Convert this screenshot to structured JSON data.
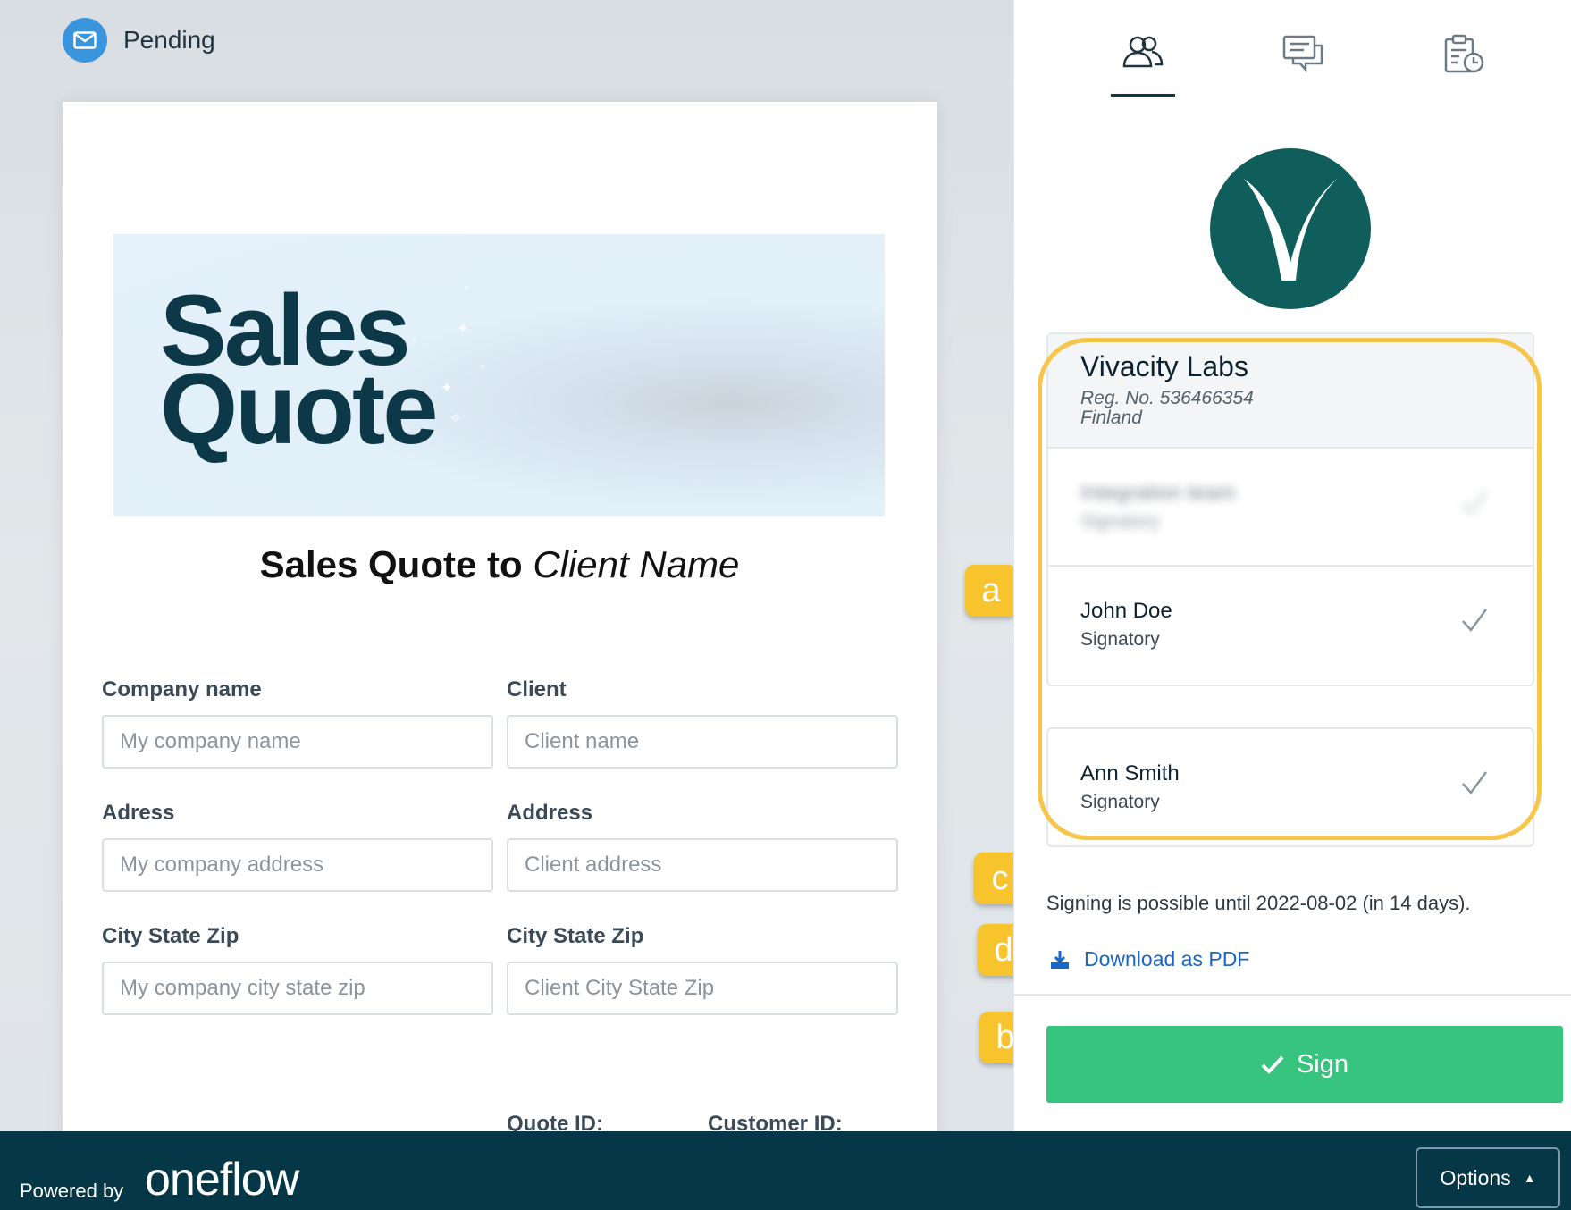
{
  "status": {
    "label": "Pending",
    "icon": "envelope-icon"
  },
  "document": {
    "banner_line1": "Sales",
    "banner_line2": "Quote",
    "title_prefix": "Sales Quote to ",
    "title_italic": "Client Name",
    "fields": [
      {
        "label": "Company name",
        "placeholder": "My company name"
      },
      {
        "label": "Client",
        "placeholder": "Client name"
      },
      {
        "label": "Adress",
        "placeholder": "My company address"
      },
      {
        "label": "Address",
        "placeholder": "Client address"
      },
      {
        "label": "City State Zip",
        "placeholder": "My company city state zip"
      },
      {
        "label": "City State Zip",
        "placeholder": "Client City State Zip"
      }
    ],
    "quote_id_label": "Quote ID:",
    "customer_id_label": "Customer ID:"
  },
  "tabs": [
    {
      "icon": "participants-icon",
      "active": true
    },
    {
      "icon": "messages-icon",
      "active": false
    },
    {
      "icon": "audit-trail-icon",
      "active": false
    }
  ],
  "party": {
    "name": "Vivacity Labs",
    "reg_no": "Reg. No. 536466354",
    "country": "Finland",
    "participants": [
      {
        "name": "Integration team",
        "role": "Signatory",
        "blurred": true
      },
      {
        "name": "John Doe",
        "role": "Signatory",
        "blurred": false
      }
    ]
  },
  "counterparty": {
    "name": "Ann Smith",
    "role": "Signatory"
  },
  "signing_note": "Signing is possible until 2022-08-02 (in 14 days).",
  "download_label": "Download as PDF",
  "sign_label": "Sign",
  "badges": {
    "a": "a",
    "b": "b",
    "c": "c",
    "d": "d"
  },
  "footer": {
    "powered_by": "Powered by",
    "brand": "oneflow",
    "options_label": "Options"
  },
  "colors": {
    "sign_green": "#36c47f",
    "brand_teal": "#0f5e5c",
    "footer_bg": "#053746",
    "highlight": "#f6c549",
    "badge": "#f8c42d",
    "link_blue": "#1b66c9"
  }
}
